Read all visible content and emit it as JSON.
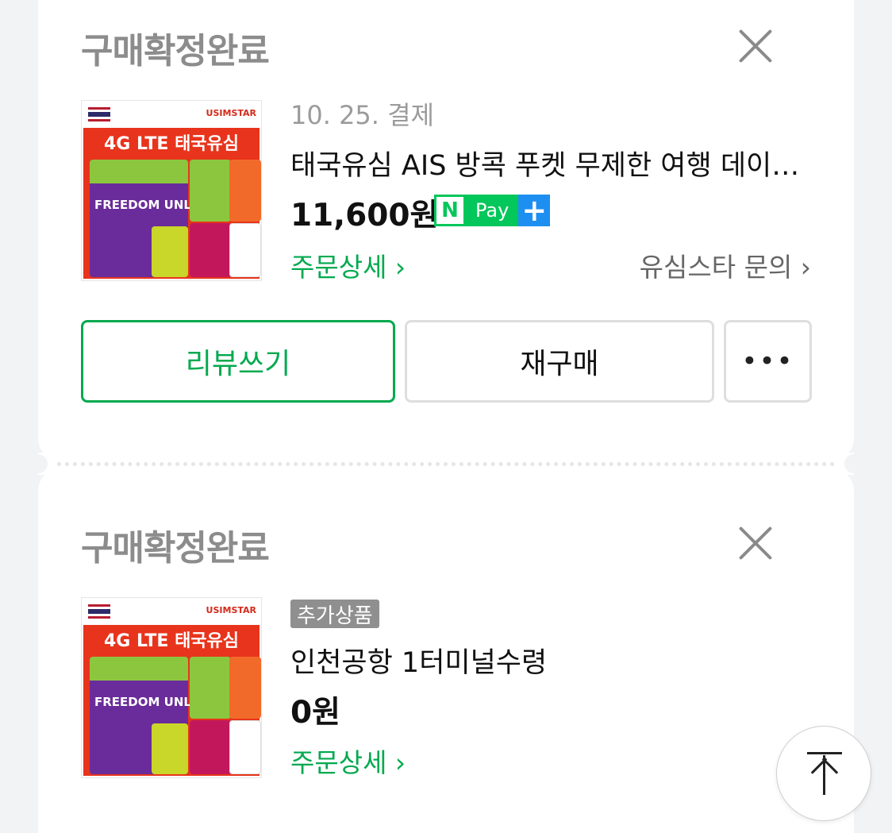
{
  "order1": {
    "status": "구매확정완료",
    "date": "10. 25. 결제",
    "product_name": "태국유심 AIS 방콕 푸켓 무제한 여행 데이터 유심",
    "price": "11,600원",
    "npay": {
      "n": "N",
      "pay": "Pay",
      "plus": "+"
    },
    "order_detail": "주문상세 ›",
    "inquiry": "유심스타 문의 ›",
    "buttons": {
      "review": "리뷰쓰기",
      "rebuy": "재구매",
      "more": "•••"
    }
  },
  "order2": {
    "status": "구매확정완료",
    "tag": "추가상품",
    "product_name": "인천공항 1터미널수령",
    "price": "0원",
    "order_detail": "주문상세 ›"
  },
  "thumbnail": {
    "brand": "USIMSTAR",
    "title": "4G LTE 태국유심",
    "sim_text": "FREEDOM UNLIMITED"
  },
  "icons": {
    "close": "close-icon",
    "scroll_top": "arrow-up-icon"
  },
  "colors": {
    "accent_green": "#03a94f",
    "npay_green": "#03c75a",
    "npay_blue": "#1d8ff0",
    "status_gray": "#8c8c8c"
  }
}
